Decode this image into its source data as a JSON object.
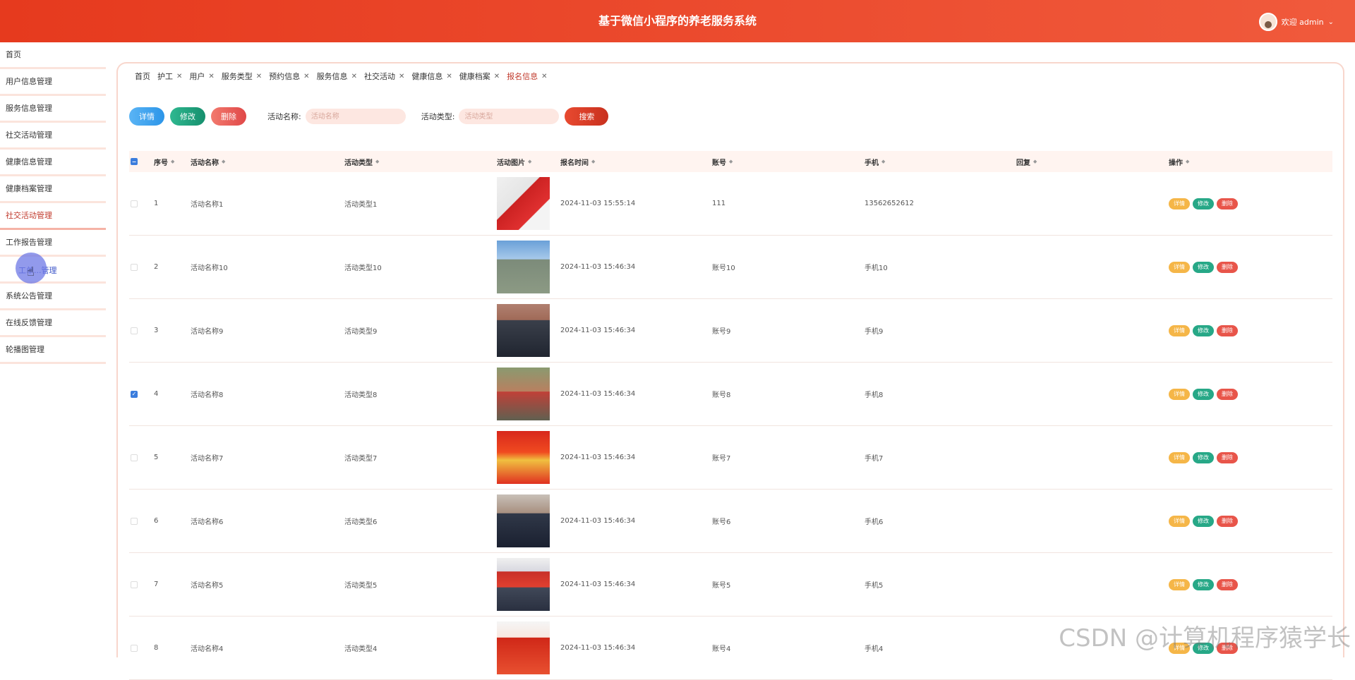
{
  "header": {
    "title": "基于微信小程序的养老服务系统",
    "welcome": "欢迎 admin",
    "chevron": "⌄"
  },
  "sidebar": {
    "items": [
      {
        "label": "首页"
      },
      {
        "label": "用户信息管理"
      },
      {
        "label": "服务信息管理"
      },
      {
        "label": "社交活动管理"
      },
      {
        "label": "健康信息管理"
      },
      {
        "label": "健康档案管理"
      },
      {
        "label": "社交活动管理"
      },
      {
        "label": "工作报告管理"
      },
      {
        "label": "工单...管理"
      },
      {
        "label": "系统公告管理"
      },
      {
        "label": "在线反馈管理"
      },
      {
        "label": "轮播图管理"
      }
    ]
  },
  "tabs": [
    {
      "label": "首页"
    },
    {
      "label": "护工"
    },
    {
      "label": "用户"
    },
    {
      "label": "服务类型"
    },
    {
      "label": "预约信息"
    },
    {
      "label": "服务信息"
    },
    {
      "label": "社交活动"
    },
    {
      "label": "健康信息"
    },
    {
      "label": "健康档案"
    },
    {
      "label": "报名信息"
    }
  ],
  "toolbar": {
    "detail": "详情",
    "edit": "修改",
    "delete": "删除",
    "name_label": "活动名称:",
    "name_placeholder": "活动名称",
    "type_label": "活动类型:",
    "type_placeholder": "活动类型",
    "search": "搜索"
  },
  "table": {
    "columns": [
      "序号",
      "活动名称",
      "活动类型",
      "活动图片",
      "报名时间",
      "账号",
      "手机",
      "回复",
      "操作"
    ],
    "rows": [
      {
        "no": "1",
        "name": "活动名称1",
        "type": "活动类型1",
        "time": "2024-11-03 15:55:14",
        "account": "111",
        "phone": "13562652612",
        "reply": "",
        "checked": false
      },
      {
        "no": "2",
        "name": "活动名称10",
        "type": "活动类型10",
        "time": "2024-11-03 15:46:34",
        "account": "账号10",
        "phone": "手机10",
        "reply": "",
        "checked": false
      },
      {
        "no": "3",
        "name": "活动名称9",
        "type": "活动类型9",
        "time": "2024-11-03 15:46:34",
        "account": "账号9",
        "phone": "手机9",
        "reply": "",
        "checked": false
      },
      {
        "no": "4",
        "name": "活动名称8",
        "type": "活动类型8",
        "time": "2024-11-03 15:46:34",
        "account": "账号8",
        "phone": "手机8",
        "reply": "",
        "checked": true
      },
      {
        "no": "5",
        "name": "活动名称7",
        "type": "活动类型7",
        "time": "2024-11-03 15:46:34",
        "account": "账号7",
        "phone": "手机7",
        "reply": "",
        "checked": false
      },
      {
        "no": "6",
        "name": "活动名称6",
        "type": "活动类型6",
        "time": "2024-11-03 15:46:34",
        "account": "账号6",
        "phone": "手机6",
        "reply": "",
        "checked": false
      },
      {
        "no": "7",
        "name": "活动名称5",
        "type": "活动类型5",
        "time": "2024-11-03 15:46:34",
        "account": "账号5",
        "phone": "手机5",
        "reply": "",
        "checked": false
      },
      {
        "no": "8",
        "name": "活动名称4",
        "type": "活动类型4",
        "time": "2024-11-03 15:46:34",
        "account": "账号4",
        "phone": "手机4",
        "reply": "",
        "checked": false
      }
    ],
    "op_labels": {
      "detail": "详情",
      "edit": "修改",
      "delete": "删除"
    }
  },
  "watermark": "CSDN @计算机程序猿学长",
  "colors": {
    "header_start": "#e63a1e",
    "header_end": "#f05a3c",
    "accent": "#c0392b",
    "checkbox": "#3b7ddd"
  }
}
